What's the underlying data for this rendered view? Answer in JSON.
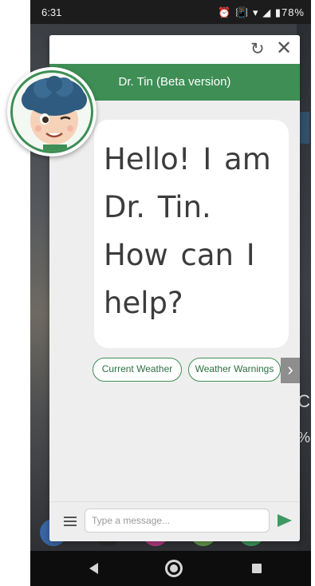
{
  "status_bar": {
    "time": "6:31",
    "icons": [
      "alarm-icon",
      "vibrate-icon",
      "wifi-icon",
      "signal-icon",
      "battery-icon"
    ],
    "battery": "78%"
  },
  "chat": {
    "title": "Dr. Tin (Beta version)",
    "header_color": "#3e8e55",
    "avatar": "dr-tin-avatar",
    "message": "Hello! I am Dr. Tin. How can I help?",
    "quick_replies": [
      "Current Weather",
      "Weather Warnings"
    ],
    "input_placeholder": "Type a message...",
    "toolbar_icons": [
      "refresh-icon",
      "close-icon"
    ]
  },
  "nav_bar": {
    "buttons": [
      "back",
      "home",
      "recents"
    ]
  }
}
